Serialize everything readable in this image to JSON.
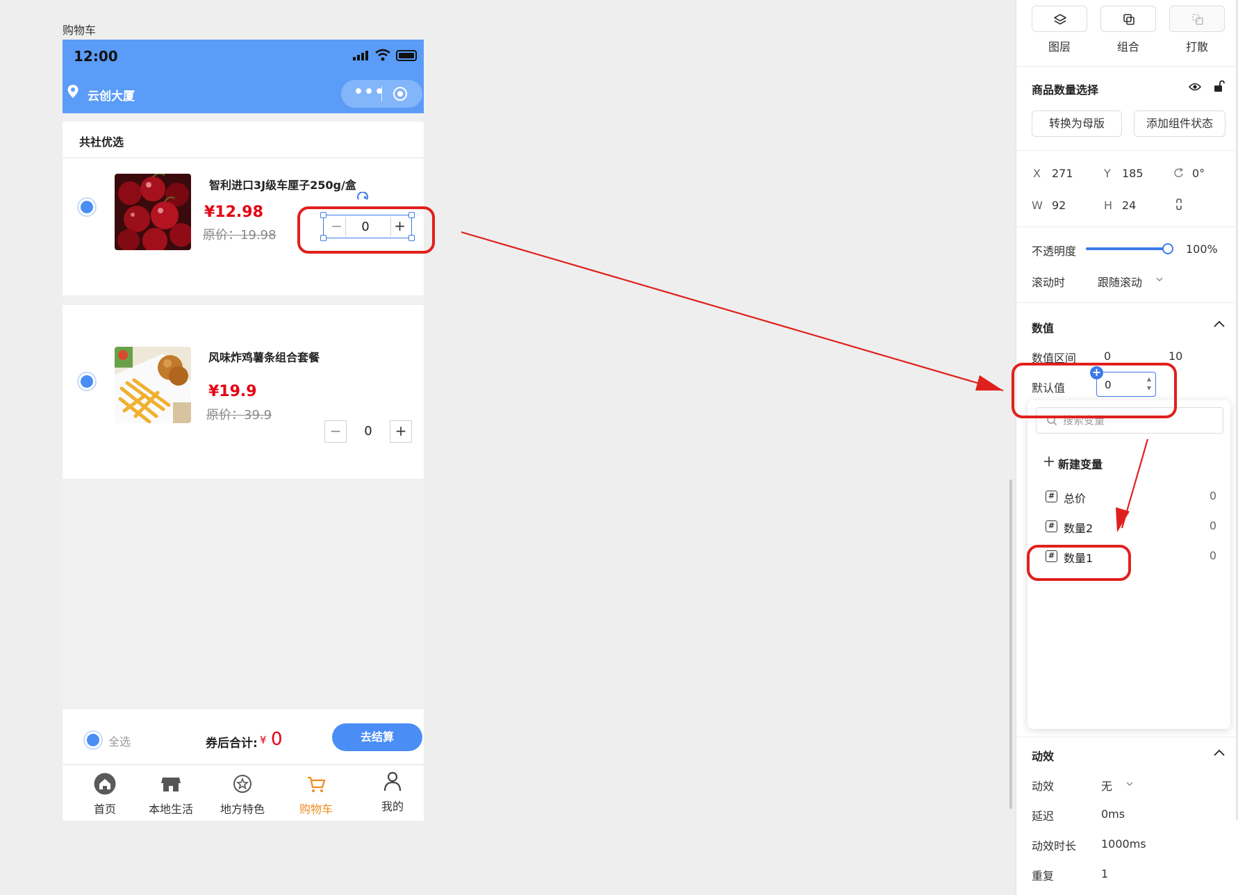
{
  "page_label": "购物车",
  "phone": {
    "status": {
      "time": "12:00"
    },
    "nav": {
      "location": "云创大厦"
    },
    "shop": {
      "name": "共社优选"
    },
    "items": [
      {
        "name": "智利进口3J级车厘子250g/盒",
        "price": "¥12.98",
        "original_price": "原价：19.98",
        "quantity": "0",
        "minus": "−",
        "plus": "+"
      },
      {
        "name": "风味炸鸡薯条组合套餐",
        "price": "¥19.9",
        "original_price": "原价：39.9",
        "quantity": "0",
        "minus": "−",
        "plus": "+"
      }
    ],
    "footer": {
      "select_all": "全选",
      "total_label": "券后合计:",
      "total_currency": "¥",
      "total_value": "0",
      "checkout": "去结算"
    },
    "tabs": [
      {
        "label": "首页",
        "icon": "home-icon"
      },
      {
        "label": "本地生活",
        "icon": "store-icon"
      },
      {
        "label": "地方特色",
        "icon": "star-icon"
      },
      {
        "label": "购物车",
        "icon": "cart-icon",
        "active": true
      },
      {
        "label": "我的",
        "icon": "user-icon"
      }
    ]
  },
  "inspector": {
    "toolbar": [
      {
        "label": "图层",
        "icon": "layers-icon"
      },
      {
        "label": "组合",
        "icon": "group-icon"
      },
      {
        "label": "打散",
        "icon": "ungroup-icon"
      }
    ],
    "component_name": "商品数量选择",
    "buttons": {
      "master": "转换为母版",
      "add_state": "添加组件状态"
    },
    "geometry": {
      "x_label": "X",
      "x": "271",
      "y_label": "Y",
      "y": "185",
      "rotation": "0°",
      "w_label": "W",
      "w": "92",
      "h_label": "H",
      "h": "24"
    },
    "opacity": {
      "label": "不透明度",
      "value": "100%",
      "level": 1.0
    },
    "scroll": {
      "label": "滚动时",
      "value": "跟随滚动"
    },
    "value_section": {
      "title": "数值",
      "range_label": "数值区间",
      "range_min": "0",
      "range_max": "10",
      "default_label": "默认值",
      "default_value": "0"
    },
    "var_menu": {
      "search_placeholder": "搜索变量",
      "new_var": "新建变量",
      "vars": [
        {
          "name": "总价",
          "value": "0"
        },
        {
          "name": "数量2",
          "value": "0"
        },
        {
          "name": "数量1",
          "value": "0"
        }
      ]
    },
    "anim_section": {
      "title": "动效",
      "anim_label": "动效",
      "anim_value": "无",
      "delay_label": "延迟",
      "delay_value": "0ms",
      "duration_label": "动效时长",
      "duration_value": "1000ms",
      "repeat_label": "重复",
      "repeat_value": "1"
    }
  },
  "colors": {
    "brand_blue": "#5a9cf8",
    "accent": "#3d7ae8",
    "price_red": "#e60012",
    "annotation_red": "#e0201c",
    "active_tab": "#f08c1e"
  }
}
